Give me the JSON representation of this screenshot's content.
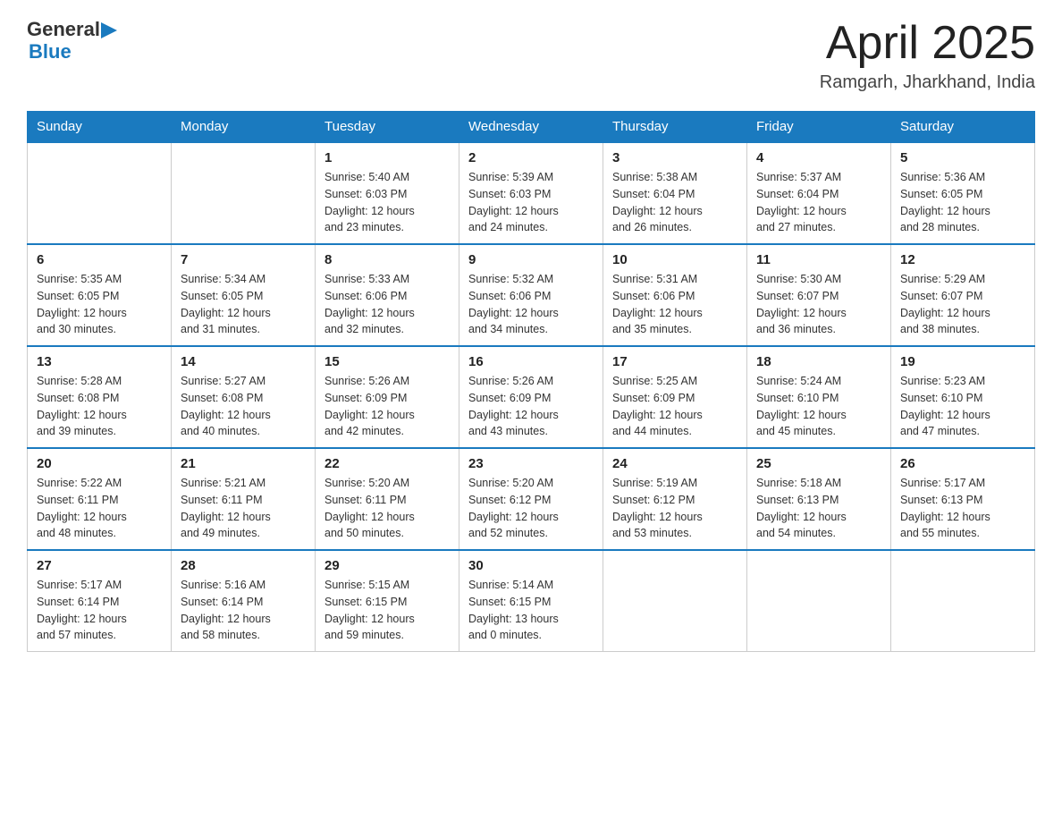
{
  "header": {
    "logo_text1": "General",
    "logo_text2": "Blue",
    "month": "April 2025",
    "location": "Ramgarh, Jharkhand, India"
  },
  "weekdays": [
    "Sunday",
    "Monday",
    "Tuesday",
    "Wednesday",
    "Thursday",
    "Friday",
    "Saturday"
  ],
  "weeks": [
    [
      {
        "day": "",
        "info": ""
      },
      {
        "day": "",
        "info": ""
      },
      {
        "day": "1",
        "info": "Sunrise: 5:40 AM\nSunset: 6:03 PM\nDaylight: 12 hours\nand 23 minutes."
      },
      {
        "day": "2",
        "info": "Sunrise: 5:39 AM\nSunset: 6:03 PM\nDaylight: 12 hours\nand 24 minutes."
      },
      {
        "day": "3",
        "info": "Sunrise: 5:38 AM\nSunset: 6:04 PM\nDaylight: 12 hours\nand 26 minutes."
      },
      {
        "day": "4",
        "info": "Sunrise: 5:37 AM\nSunset: 6:04 PM\nDaylight: 12 hours\nand 27 minutes."
      },
      {
        "day": "5",
        "info": "Sunrise: 5:36 AM\nSunset: 6:05 PM\nDaylight: 12 hours\nand 28 minutes."
      }
    ],
    [
      {
        "day": "6",
        "info": "Sunrise: 5:35 AM\nSunset: 6:05 PM\nDaylight: 12 hours\nand 30 minutes."
      },
      {
        "day": "7",
        "info": "Sunrise: 5:34 AM\nSunset: 6:05 PM\nDaylight: 12 hours\nand 31 minutes."
      },
      {
        "day": "8",
        "info": "Sunrise: 5:33 AM\nSunset: 6:06 PM\nDaylight: 12 hours\nand 32 minutes."
      },
      {
        "day": "9",
        "info": "Sunrise: 5:32 AM\nSunset: 6:06 PM\nDaylight: 12 hours\nand 34 minutes."
      },
      {
        "day": "10",
        "info": "Sunrise: 5:31 AM\nSunset: 6:06 PM\nDaylight: 12 hours\nand 35 minutes."
      },
      {
        "day": "11",
        "info": "Sunrise: 5:30 AM\nSunset: 6:07 PM\nDaylight: 12 hours\nand 36 minutes."
      },
      {
        "day": "12",
        "info": "Sunrise: 5:29 AM\nSunset: 6:07 PM\nDaylight: 12 hours\nand 38 minutes."
      }
    ],
    [
      {
        "day": "13",
        "info": "Sunrise: 5:28 AM\nSunset: 6:08 PM\nDaylight: 12 hours\nand 39 minutes."
      },
      {
        "day": "14",
        "info": "Sunrise: 5:27 AM\nSunset: 6:08 PM\nDaylight: 12 hours\nand 40 minutes."
      },
      {
        "day": "15",
        "info": "Sunrise: 5:26 AM\nSunset: 6:09 PM\nDaylight: 12 hours\nand 42 minutes."
      },
      {
        "day": "16",
        "info": "Sunrise: 5:26 AM\nSunset: 6:09 PM\nDaylight: 12 hours\nand 43 minutes."
      },
      {
        "day": "17",
        "info": "Sunrise: 5:25 AM\nSunset: 6:09 PM\nDaylight: 12 hours\nand 44 minutes."
      },
      {
        "day": "18",
        "info": "Sunrise: 5:24 AM\nSunset: 6:10 PM\nDaylight: 12 hours\nand 45 minutes."
      },
      {
        "day": "19",
        "info": "Sunrise: 5:23 AM\nSunset: 6:10 PM\nDaylight: 12 hours\nand 47 minutes."
      }
    ],
    [
      {
        "day": "20",
        "info": "Sunrise: 5:22 AM\nSunset: 6:11 PM\nDaylight: 12 hours\nand 48 minutes."
      },
      {
        "day": "21",
        "info": "Sunrise: 5:21 AM\nSunset: 6:11 PM\nDaylight: 12 hours\nand 49 minutes."
      },
      {
        "day": "22",
        "info": "Sunrise: 5:20 AM\nSunset: 6:11 PM\nDaylight: 12 hours\nand 50 minutes."
      },
      {
        "day": "23",
        "info": "Sunrise: 5:20 AM\nSunset: 6:12 PM\nDaylight: 12 hours\nand 52 minutes."
      },
      {
        "day": "24",
        "info": "Sunrise: 5:19 AM\nSunset: 6:12 PM\nDaylight: 12 hours\nand 53 minutes."
      },
      {
        "day": "25",
        "info": "Sunrise: 5:18 AM\nSunset: 6:13 PM\nDaylight: 12 hours\nand 54 minutes."
      },
      {
        "day": "26",
        "info": "Sunrise: 5:17 AM\nSunset: 6:13 PM\nDaylight: 12 hours\nand 55 minutes."
      }
    ],
    [
      {
        "day": "27",
        "info": "Sunrise: 5:17 AM\nSunset: 6:14 PM\nDaylight: 12 hours\nand 57 minutes."
      },
      {
        "day": "28",
        "info": "Sunrise: 5:16 AM\nSunset: 6:14 PM\nDaylight: 12 hours\nand 58 minutes."
      },
      {
        "day": "29",
        "info": "Sunrise: 5:15 AM\nSunset: 6:15 PM\nDaylight: 12 hours\nand 59 minutes."
      },
      {
        "day": "30",
        "info": "Sunrise: 5:14 AM\nSunset: 6:15 PM\nDaylight: 13 hours\nand 0 minutes."
      },
      {
        "day": "",
        "info": ""
      },
      {
        "day": "",
        "info": ""
      },
      {
        "day": "",
        "info": ""
      }
    ]
  ]
}
